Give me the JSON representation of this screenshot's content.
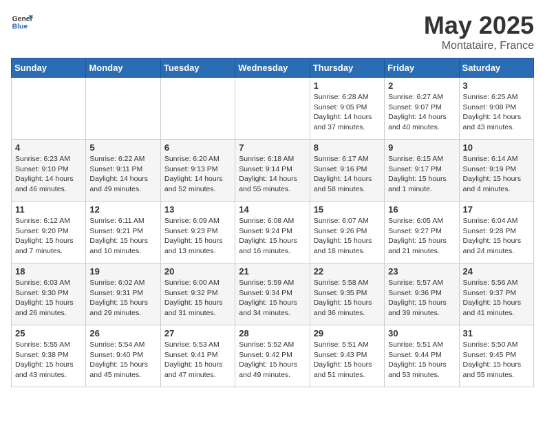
{
  "logo": {
    "general": "General",
    "blue": "Blue"
  },
  "title": "May 2025",
  "subtitle": "Montataire, France",
  "days_of_week": [
    "Sunday",
    "Monday",
    "Tuesday",
    "Wednesday",
    "Thursday",
    "Friday",
    "Saturday"
  ],
  "weeks": [
    [
      {
        "day": "",
        "info": ""
      },
      {
        "day": "",
        "info": ""
      },
      {
        "day": "",
        "info": ""
      },
      {
        "day": "",
        "info": ""
      },
      {
        "day": "1",
        "info": "Sunrise: 6:28 AM\nSunset: 9:05 PM\nDaylight: 14 hours\nand 37 minutes."
      },
      {
        "day": "2",
        "info": "Sunrise: 6:27 AM\nSunset: 9:07 PM\nDaylight: 14 hours\nand 40 minutes."
      },
      {
        "day": "3",
        "info": "Sunrise: 6:25 AM\nSunset: 9:08 PM\nDaylight: 14 hours\nand 43 minutes."
      }
    ],
    [
      {
        "day": "4",
        "info": "Sunrise: 6:23 AM\nSunset: 9:10 PM\nDaylight: 14 hours\nand 46 minutes."
      },
      {
        "day": "5",
        "info": "Sunrise: 6:22 AM\nSunset: 9:11 PM\nDaylight: 14 hours\nand 49 minutes."
      },
      {
        "day": "6",
        "info": "Sunrise: 6:20 AM\nSunset: 9:13 PM\nDaylight: 14 hours\nand 52 minutes."
      },
      {
        "day": "7",
        "info": "Sunrise: 6:18 AM\nSunset: 9:14 PM\nDaylight: 14 hours\nand 55 minutes."
      },
      {
        "day": "8",
        "info": "Sunrise: 6:17 AM\nSunset: 9:16 PM\nDaylight: 14 hours\nand 58 minutes."
      },
      {
        "day": "9",
        "info": "Sunrise: 6:15 AM\nSunset: 9:17 PM\nDaylight: 15 hours\nand 1 minute."
      },
      {
        "day": "10",
        "info": "Sunrise: 6:14 AM\nSunset: 9:19 PM\nDaylight: 15 hours\nand 4 minutes."
      }
    ],
    [
      {
        "day": "11",
        "info": "Sunrise: 6:12 AM\nSunset: 9:20 PM\nDaylight: 15 hours\nand 7 minutes."
      },
      {
        "day": "12",
        "info": "Sunrise: 6:11 AM\nSunset: 9:21 PM\nDaylight: 15 hours\nand 10 minutes."
      },
      {
        "day": "13",
        "info": "Sunrise: 6:09 AM\nSunset: 9:23 PM\nDaylight: 15 hours\nand 13 minutes."
      },
      {
        "day": "14",
        "info": "Sunrise: 6:08 AM\nSunset: 9:24 PM\nDaylight: 15 hours\nand 16 minutes."
      },
      {
        "day": "15",
        "info": "Sunrise: 6:07 AM\nSunset: 9:26 PM\nDaylight: 15 hours\nand 18 minutes."
      },
      {
        "day": "16",
        "info": "Sunrise: 6:05 AM\nSunset: 9:27 PM\nDaylight: 15 hours\nand 21 minutes."
      },
      {
        "day": "17",
        "info": "Sunrise: 6:04 AM\nSunset: 9:28 PM\nDaylight: 15 hours\nand 24 minutes."
      }
    ],
    [
      {
        "day": "18",
        "info": "Sunrise: 6:03 AM\nSunset: 9:30 PM\nDaylight: 15 hours\nand 26 minutes."
      },
      {
        "day": "19",
        "info": "Sunrise: 6:02 AM\nSunset: 9:31 PM\nDaylight: 15 hours\nand 29 minutes."
      },
      {
        "day": "20",
        "info": "Sunrise: 6:00 AM\nSunset: 9:32 PM\nDaylight: 15 hours\nand 31 minutes."
      },
      {
        "day": "21",
        "info": "Sunrise: 5:59 AM\nSunset: 9:34 PM\nDaylight: 15 hours\nand 34 minutes."
      },
      {
        "day": "22",
        "info": "Sunrise: 5:58 AM\nSunset: 9:35 PM\nDaylight: 15 hours\nand 36 minutes."
      },
      {
        "day": "23",
        "info": "Sunrise: 5:57 AM\nSunset: 9:36 PM\nDaylight: 15 hours\nand 39 minutes."
      },
      {
        "day": "24",
        "info": "Sunrise: 5:56 AM\nSunset: 9:37 PM\nDaylight: 15 hours\nand 41 minutes."
      }
    ],
    [
      {
        "day": "25",
        "info": "Sunrise: 5:55 AM\nSunset: 9:38 PM\nDaylight: 15 hours\nand 43 minutes."
      },
      {
        "day": "26",
        "info": "Sunrise: 5:54 AM\nSunset: 9:40 PM\nDaylight: 15 hours\nand 45 minutes."
      },
      {
        "day": "27",
        "info": "Sunrise: 5:53 AM\nSunset: 9:41 PM\nDaylight: 15 hours\nand 47 minutes."
      },
      {
        "day": "28",
        "info": "Sunrise: 5:52 AM\nSunset: 9:42 PM\nDaylight: 15 hours\nand 49 minutes."
      },
      {
        "day": "29",
        "info": "Sunrise: 5:51 AM\nSunset: 9:43 PM\nDaylight: 15 hours\nand 51 minutes."
      },
      {
        "day": "30",
        "info": "Sunrise: 5:51 AM\nSunset: 9:44 PM\nDaylight: 15 hours\nand 53 minutes."
      },
      {
        "day": "31",
        "info": "Sunrise: 5:50 AM\nSunset: 9:45 PM\nDaylight: 15 hours\nand 55 minutes."
      }
    ]
  ]
}
